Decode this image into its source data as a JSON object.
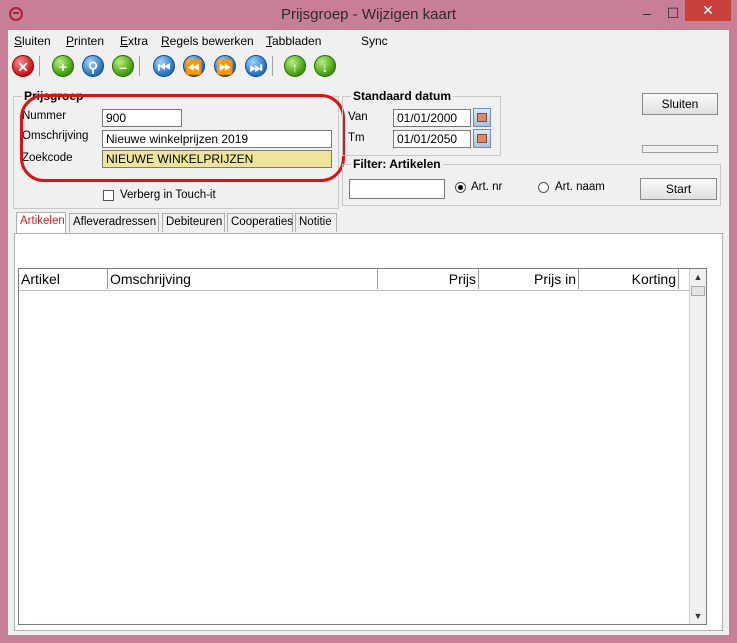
{
  "window": {
    "title": "Prijsgroep - Wijzigen kaart"
  },
  "menu": [
    {
      "label": "Sluiten",
      "ul": "S",
      "rest": "luiten"
    },
    {
      "label": "Printen",
      "ul": "P",
      "rest": "rinten"
    },
    {
      "label": "Extra",
      "ul": "E",
      "rest": "xtra"
    },
    {
      "label": "Regels bewerken",
      "ul": "R",
      "rest": "egels bewerken"
    },
    {
      "label": "Tabbladen",
      "ul": "T",
      "rest": "abbladen"
    },
    {
      "label": "Sync",
      "ul": "",
      "rest": "Sync"
    }
  ],
  "toolbar": {
    "icons": [
      "delete-icon",
      "add-icon",
      "search-icon",
      "remove-icon",
      "first-icon",
      "previous-icon",
      "next-icon",
      "last-icon",
      "up-icon",
      "down-icon"
    ],
    "colors": {
      "red": "#d01010",
      "green": "#3c9a0a",
      "blue": "#1f6fc2"
    }
  },
  "prijsgroep": {
    "title": "Prijsgroep",
    "nummer_label": "Nummer",
    "nummer_value": "900",
    "omschrijving_label": "Omschrijving",
    "omschrijving_value": "Nieuwe winkelprijzen 2019",
    "zoekcode_label": "Zoekcode",
    "zoekcode_value": "NIEUWE WINKELPRIJZEN",
    "checkbox_label": "Verberg in Touch-it"
  },
  "standaard_datum": {
    "title": "Standaard datum",
    "van_label": "Van",
    "van_value": "01/01/2000",
    "tm_label": "Tm",
    "tm_value": "01/01/2050"
  },
  "filter": {
    "title": "Filter: Artikelen",
    "input_value": "",
    "radio_artnr": "Art. nr",
    "radio_artnaam": "Art. naam",
    "start_label": "Start"
  },
  "sluiten_button": "Sluiten",
  "tabs": [
    "Artikelen",
    "Afleveradressen",
    "Debiteuren",
    "Cooperaties",
    "Notitie"
  ],
  "grid": {
    "columns": [
      "Artikel",
      "Omschrijving",
      "Prijs",
      "Prijs in",
      "Korting"
    ]
  },
  "highlight_color": "#e01010"
}
